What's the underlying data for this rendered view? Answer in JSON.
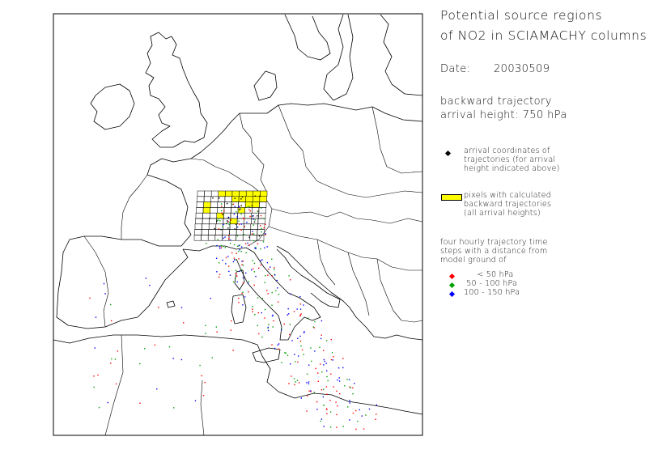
{
  "title_line1": "Potential source regions",
  "title_line2": "of NO2 in SCIAMACHY columns",
  "date_label": "Date:",
  "date_value": "20030509",
  "trajectory_line1": "backward trajectory",
  "trajectory_line2": "arrival height: 750 hPa",
  "legend": {
    "arrival": {
      "lines": [
        "arrival coordinates of",
        "trajectories (for arrival",
        "height indicated above)"
      ],
      "color": "#000000"
    },
    "pixels": {
      "lines": [
        "pixels with calculated",
        "backward trajectories",
        "(all arrival heights)"
      ],
      "color": "#ffff00"
    },
    "steps_header": [
      "four hourly trajectory time",
      "steps with a distance from",
      "model ground of"
    ],
    "ranges": [
      {
        "label": "     < 50 hPa",
        "color": "#ff0000"
      },
      {
        "label": " 50 - 100 hPa",
        "color": "#00a000"
      },
      {
        "label": "100 - 150 hPa",
        "color": "#0000ff"
      }
    ]
  }
}
